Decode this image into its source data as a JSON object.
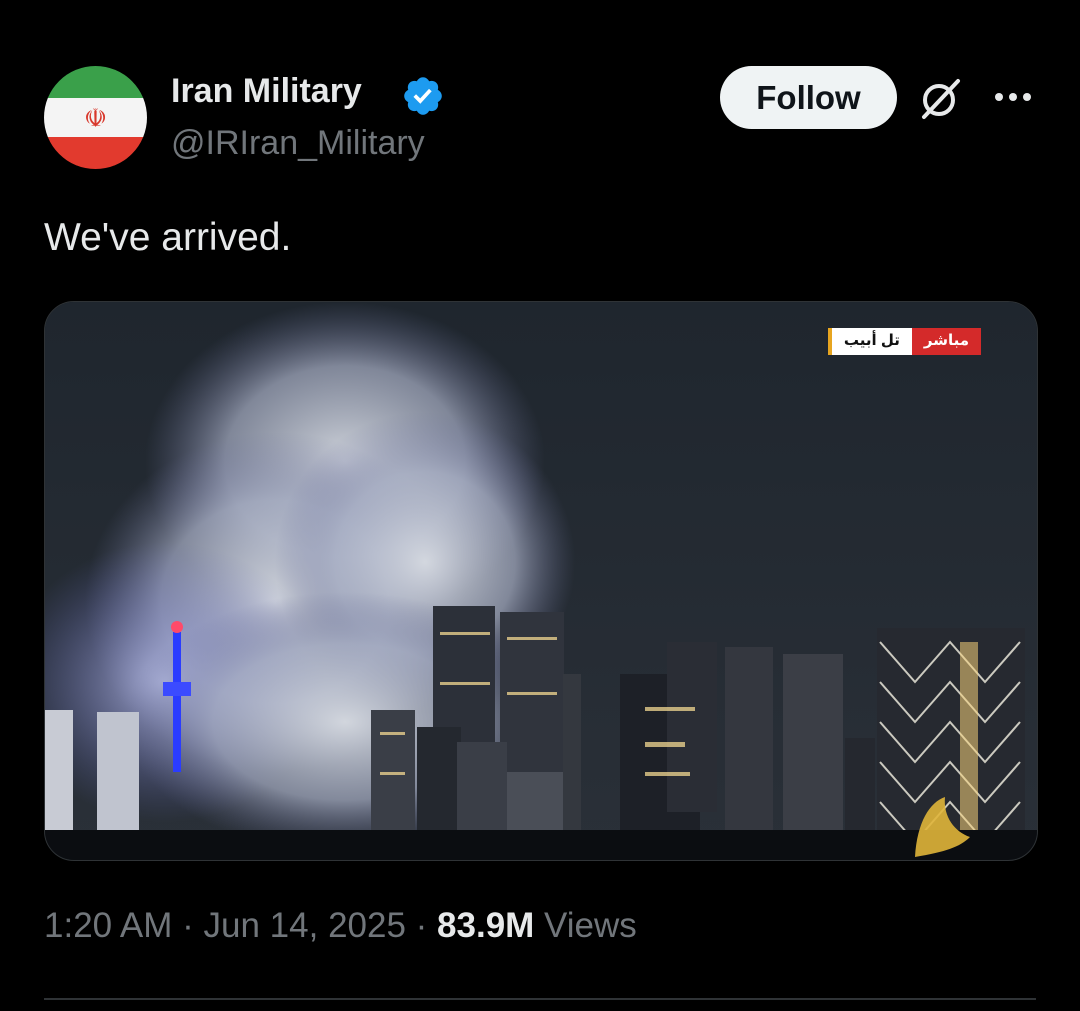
{
  "author": {
    "name": "Iran Military",
    "handle": "@IRIran_Military",
    "verified": true,
    "avatar_emblem_glyph": "☫"
  },
  "actions": {
    "follow_label": "Follow"
  },
  "icons": {
    "verified": "verified-badge-icon",
    "grok": "grok-icon",
    "more": "more-options-icon"
  },
  "tweet": {
    "text": "We've arrived.",
    "media_overlay": {
      "city": "تل أبيب",
      "live": "مباشر"
    }
  },
  "meta": {
    "time": "1:20 AM",
    "sep1": " · ",
    "date": "Jun 14, 2025",
    "sep2": " · ",
    "views_count": "83.9M",
    "views_label": " Views"
  },
  "colors": {
    "background": "#000000",
    "text_primary": "#e7e9ea",
    "text_secondary": "#71767b",
    "verified_blue": "#1d9bf0",
    "follow_bg": "#eff3f4",
    "divider": "#2f3336"
  }
}
